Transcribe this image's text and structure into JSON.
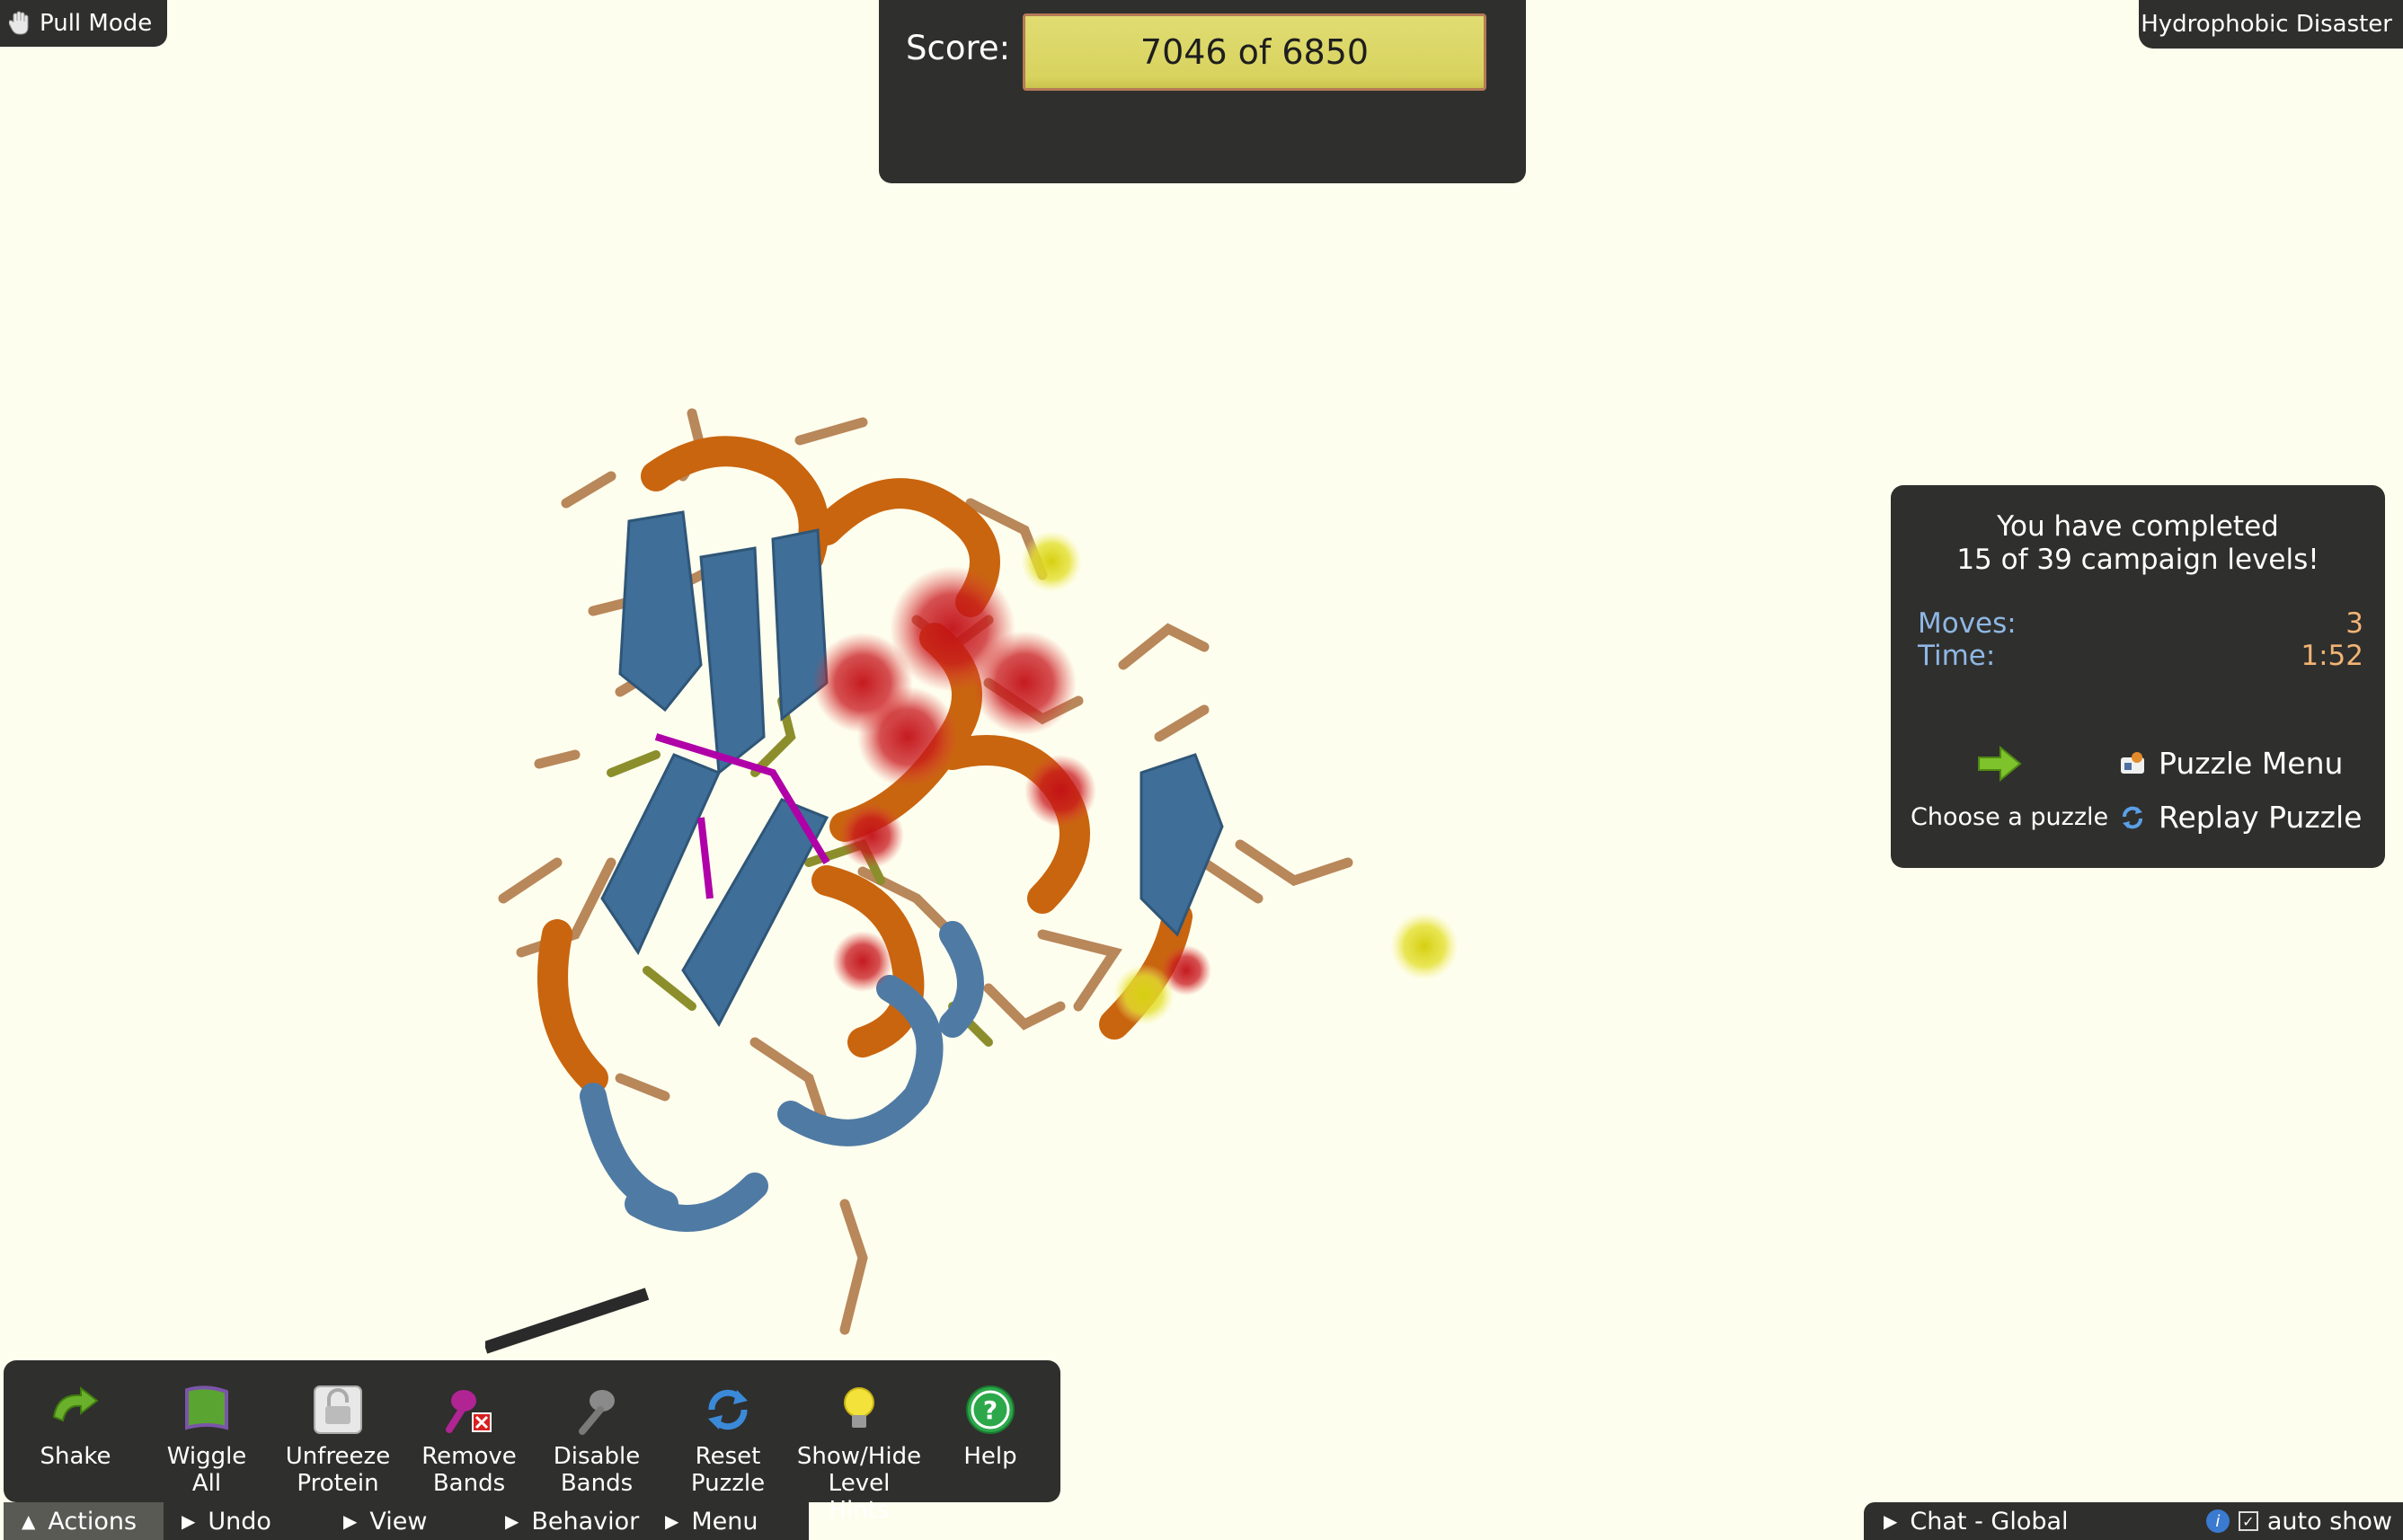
{
  "mode": {
    "label": "Pull Mode",
    "icon": "hand-icon"
  },
  "puzzle": {
    "name": "Hydrophobic Disaster"
  },
  "score": {
    "label": "Score:",
    "value": "7046 of 6850"
  },
  "status": {
    "message_line1": "You have completed",
    "message_line2": "15 of 39 campaign levels!",
    "moves_label": "Moves:",
    "moves_value": "3",
    "time_label": "Time:",
    "time_value": "1:52",
    "choose_label": "Choose a puzzle",
    "puzzle_menu_label": "Puzzle Menu",
    "replay_label": "Replay Puzzle"
  },
  "toolbar": {
    "tools": [
      {
        "line1": "Shake",
        "line2": "",
        "icon": "shake-arrow-icon"
      },
      {
        "line1": "Wiggle",
        "line2": "All",
        "icon": "wiggle-flag-icon"
      },
      {
        "line1": "Unfreeze",
        "line2": "Protein",
        "icon": "lock-icon"
      },
      {
        "line1": "Remove",
        "line2": "Bands",
        "icon": "remove-band-icon"
      },
      {
        "line1": "Disable",
        "line2": "Bands",
        "icon": "disable-band-icon"
      },
      {
        "line1": "Reset",
        "line2": "Puzzle",
        "icon": "reset-icon"
      },
      {
        "line1": "Show/Hide",
        "line2": "Level Hints",
        "icon": "lightbulb-icon"
      },
      {
        "line1": "Help",
        "line2": "",
        "icon": "help-icon"
      }
    ]
  },
  "tabs": [
    {
      "label": "Actions",
      "active": true
    },
    {
      "label": "Undo",
      "active": false
    },
    {
      "label": "View",
      "active": false
    },
    {
      "label": "Behavior",
      "active": false
    },
    {
      "label": "Menu",
      "active": false
    }
  ],
  "chat": {
    "label": "Chat - Global",
    "auto_show_label": "auto show"
  },
  "colors": {
    "background": "#fefeee",
    "panel": "#2f2f2d",
    "score_box": "#d8d35f",
    "stat_label": "#8fb7e4",
    "stat_value": "#f2b374",
    "protein_orange": "#c9650f",
    "protein_blue": "#3f6e98",
    "hydrophobic_red": "#c20f15",
    "band_magenta": "#b000a8"
  }
}
